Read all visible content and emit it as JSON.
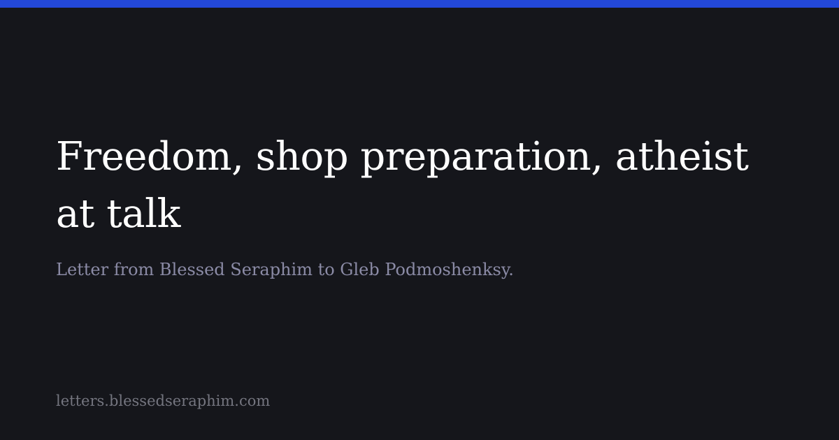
{
  "card": {
    "title": "Freedom, shop preparation, atheist at talk",
    "subtitle": "Letter from Blessed Seraphim to Gleb Podmoshenksy.",
    "domain": "letters.blessedseraphim.com"
  },
  "colors": {
    "background": "#15161b",
    "accent_bar": "#2348d8",
    "title": "#ffffff",
    "subtitle": "#8b8ba6",
    "domain": "#74757f"
  }
}
